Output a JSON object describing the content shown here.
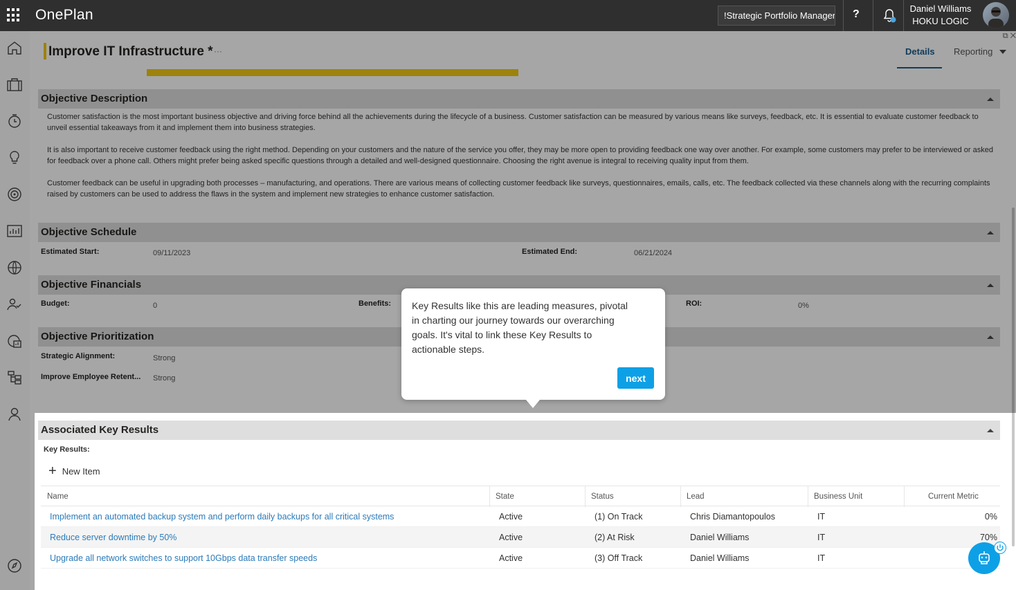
{
  "topbar": {
    "app_name": "OnePlan",
    "role_selector": "!Strategic Portfolio Manager",
    "help_label": "?",
    "user_name": "Daniel Williams",
    "org_name": "HOKU LOGIC"
  },
  "nav_icons": [
    "home-icon",
    "briefcase-icon",
    "timer-icon",
    "lightbulb-icon",
    "target-icon",
    "chart-icon",
    "globe-icon",
    "people-icon",
    "report-icon",
    "hierarchy-icon",
    "person-icon",
    "compass-icon"
  ],
  "header": {
    "title": "Improve IT Infrastructure *",
    "more": "···",
    "tab_details": "Details",
    "tab_reporting": "Reporting"
  },
  "description": {
    "title": "Objective Description",
    "paragraphs": [
      "Customer satisfaction is the most important business objective and driving force behind all the achievements during the lifecycle of a business. Customer satisfaction can be measured by various means like surveys, feedback, etc. It is essential to evaluate customer feedback to unveil essential takeaways from it and implement them into business strategies.",
      "It is also important to receive customer feedback using the right method. Depending on your customers and the nature of the service you offer, they may be more open to providing feedback one way over another. For example, some customers may prefer to be interviewed or asked for feedback over a phone call. Others might prefer being asked specific questions through a detailed and well-designed questionnaire. Choosing the right avenue is integral to receiving quality input from them.",
      "Customer feedback can be useful in upgrading both processes – manufacturing, and operations. There are various means of collecting customer feedback like surveys, questionnaires, emails, calls, etc. The feedback collected via these channels along with the recurring complaints raised by customers can be used to address the flaws in the system and implement new strategies to enhance customer satisfaction."
    ]
  },
  "schedule": {
    "title": "Objective Schedule",
    "start_label": "Estimated Start:",
    "start_value": "09/11/2023",
    "end_label": "Estimated End:",
    "end_value": "06/21/2024"
  },
  "financials": {
    "title": "Objective Financials",
    "budget_label": "Budget:",
    "budget_value": "0",
    "benefits_label": "Benefits:",
    "roi_label": "ROI:",
    "roi_value": "0%"
  },
  "prioritization": {
    "title": "Objective Prioritization",
    "alignment_label": "Strategic Alignment:",
    "alignment_value": "Strong",
    "retention_label": "Improve Employee Retent...",
    "retention_value": "Strong"
  },
  "key_results": {
    "title": "Associated Key Results",
    "subtitle": "Key Results:",
    "new_item": "New Item",
    "columns": [
      "Name",
      "State",
      "Status",
      "Lead",
      "Business Unit",
      "Current Metric"
    ],
    "rows": [
      {
        "name": "Implement an automated backup system and perform daily backups for all critical systems",
        "state": "Active",
        "status": "(1) On Track",
        "lead": "Chris Diamantopoulos",
        "unit": "IT",
        "metric": "0%"
      },
      {
        "name": "Reduce server downtime by 50%",
        "state": "Active",
        "status": "(2) At Risk",
        "lead": "Daniel Williams",
        "unit": "IT",
        "metric": "70%"
      },
      {
        "name": "Upgrade all network switches to support 10Gbps data transfer speeds",
        "state": "Active",
        "status": "(3) Off Track",
        "lead": "Daniel Williams",
        "unit": "IT",
        "metric": ""
      }
    ]
  },
  "tooltip": {
    "text": "Key Results like this are leading measures, pivotal in charting our journey towards our overarching goals. It's vital to link these Key Results to actionable steps.",
    "next": "next"
  },
  "colors": {
    "topbar": "#2f2f2f",
    "accent": "#f2c811",
    "link": "#2b7bb9",
    "primary_button": "#0ea0e6"
  }
}
